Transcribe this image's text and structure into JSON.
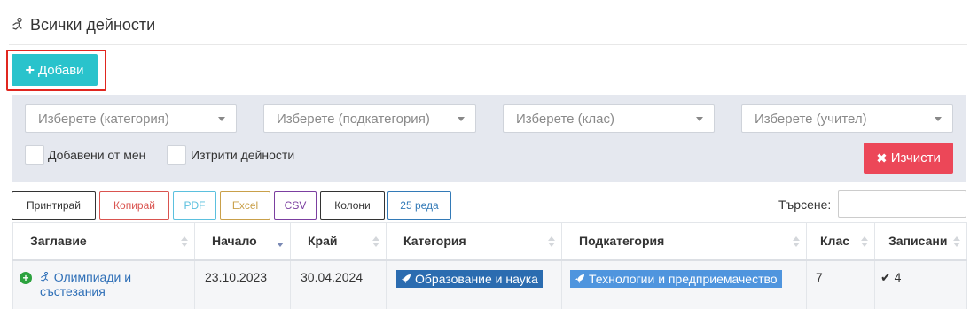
{
  "header": {
    "title": "Всички дейности",
    "icon": "running-icon"
  },
  "add_button": {
    "label": "Добави",
    "icon": "plus-icon"
  },
  "filters": {
    "category_placeholder": "Изберете (категория)",
    "subcategory_placeholder": "Изберете (подкатегория)",
    "class_placeholder": "Изберете (клас)",
    "teacher_placeholder": "Изберете (учител)",
    "added_by_me": "Добавени от мен",
    "deleted_activities": "Изтрити дейности",
    "clear_label": "Изчисти"
  },
  "toolbar": {
    "print": "Принтирай",
    "copy": "Копирай",
    "pdf": "PDF",
    "excel": "Excel",
    "csv": "CSV",
    "columns": "Колони",
    "rows": "25 реда",
    "search_label": "Търсене:"
  },
  "colors": {
    "accent": "#29c3cc",
    "danger": "#ec4758",
    "highlight": "#e0261f",
    "copy": "#d9534f",
    "pdf": "#5bc0de",
    "excel": "#c9a04a",
    "csv": "#7b3fa0",
    "rows": "#337ab7"
  },
  "table": {
    "headers": [
      "Заглавие",
      "Начало",
      "Край",
      "Категория",
      "Подкатегория",
      "Клас",
      "Записани"
    ],
    "rows": [
      {
        "title_line1": "Олимпиади и",
        "title_line2": "състезания",
        "start": "23.10.2023",
        "end": "30.04.2024",
        "category": "Образование и наука",
        "subcategory": "Технологии и предприемачество",
        "class": "7",
        "enrolled": "4"
      }
    ]
  }
}
